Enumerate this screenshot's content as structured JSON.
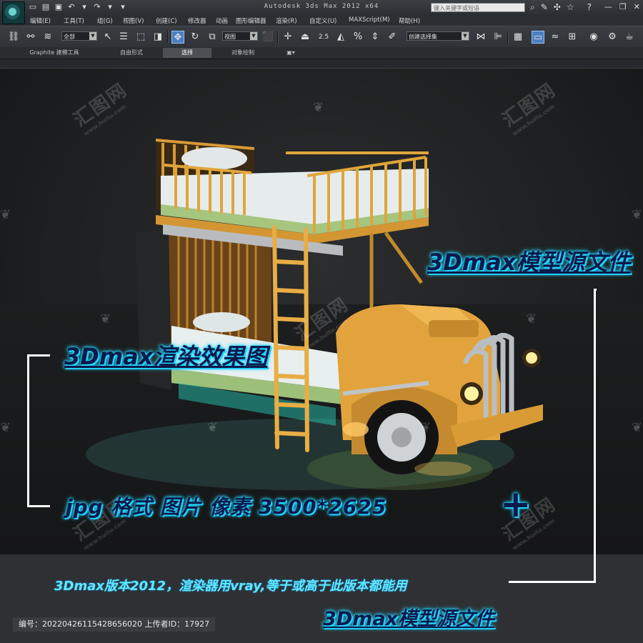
{
  "window": {
    "title": "Autodesk 3ds Max  2012 x64",
    "search_placeholder": "键入关键字或短语"
  },
  "menu": [
    "编辑(E)",
    "工具(T)",
    "组(G)",
    "视图(V)",
    "创建(C)",
    "修改器",
    "动画",
    "图形编辑器",
    "渲染(R)",
    "自定义(U)",
    "MAXScript(M)",
    "帮助(H)"
  ],
  "toolbar": {
    "selection_filter": "全部",
    "reference_coord": "视图",
    "snap_value": "2.5",
    "named_selection": "创建选择集"
  },
  "ribbon": {
    "tabs": [
      "Graphite 建模工具",
      "自由形式",
      "选择",
      "对象绘制"
    ]
  },
  "captions": {
    "model_source_top": "3Dmax模型源文件",
    "render_result": "3Dmax渲染效果图",
    "format_info": "jpg 格式 图片 像素 3500*2625",
    "plus": "+",
    "version_note": "3Dmax版本2012，渲染器用vray,等于或高于此版本都能用",
    "model_source_bottom": "3Dmax模型源文件"
  },
  "watermark": {
    "brand": "汇图网",
    "url": "www.huitu.com"
  },
  "footer": {
    "id_line": "编号：20220426115428656020 上传者ID：17927"
  },
  "colors": {
    "caption_glow": "#27d7ff",
    "bed_frame": "#e0a53a",
    "chrome_bg": "#2f3236"
  }
}
